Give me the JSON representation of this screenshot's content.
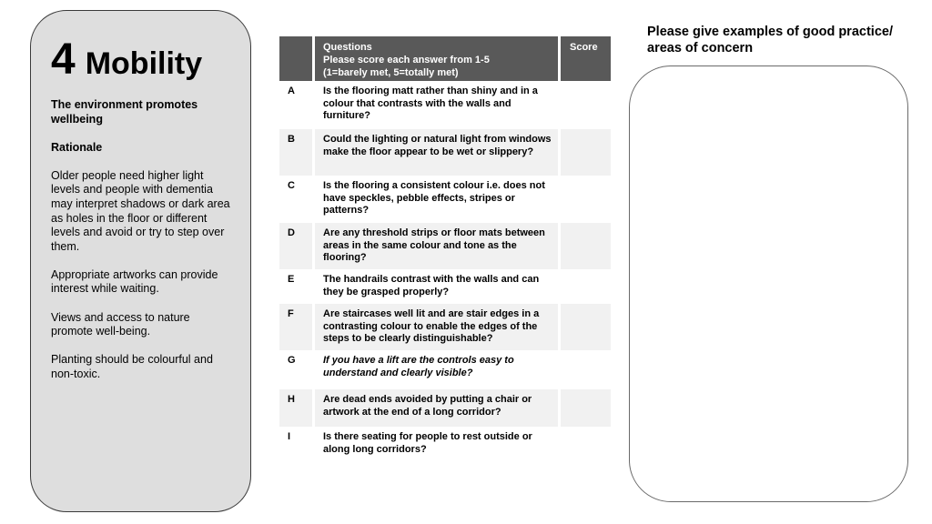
{
  "section": {
    "number": "4",
    "title": "Mobility",
    "subtitle": "The environment promotes wellbeing",
    "rationale_heading": "Rationale",
    "paragraphs": [
      "Older people need higher light levels and people with dementia may interpret shadows or dark area as holes in the floor or different levels and avoid or try to step over them.",
      "Appropriate artworks can provide interest while waiting.",
      "Views and access to nature promote well-being.",
      "Planting should be colourful and non-toxic."
    ]
  },
  "table": {
    "header": {
      "questions_title": "Questions",
      "questions_instruction": "Please score each answer from 1-5",
      "questions_scale": "(1=barely met, 5=totally met)",
      "score": "Score"
    },
    "rows": [
      {
        "label": "A",
        "question": "Is the flooring matt rather than shiny and in a colour that contrasts with the walls and furniture?",
        "score": ""
      },
      {
        "label": "B",
        "question": "Could the lighting or natural light from windows make the floor appear to be wet or slippery?",
        "score": ""
      },
      {
        "label": "C",
        "question": "Is the flooring a consistent colour i.e. does not have speckles, pebble effects, stripes or patterns?",
        "score": ""
      },
      {
        "label": "D",
        "question": "Are any threshold strips or floor mats between areas in the same colour and tone as the flooring?",
        "score": ""
      },
      {
        "label": "E",
        "question": "The handrails contrast with the walls and can they be grasped properly?",
        "score": ""
      },
      {
        "label": "F",
        "question": "Are staircases well lit and are stair edges in a contrasting colour to enable the edges of the steps to be clearly distinguishable?",
        "score": ""
      },
      {
        "label": "G",
        "question": "If you have a lift are the controls easy to understand and clearly visible?",
        "score": ""
      },
      {
        "label": "H",
        "question": "Are dead ends avoided by putting a chair or artwork at the end of a long corridor?",
        "score": ""
      },
      {
        "label": "I",
        "question": "Is there seating for people to rest outside or along long corridors?",
        "score": ""
      }
    ]
  },
  "notes": {
    "title": "Please give examples of good practice/ areas of concern",
    "value": ""
  }
}
